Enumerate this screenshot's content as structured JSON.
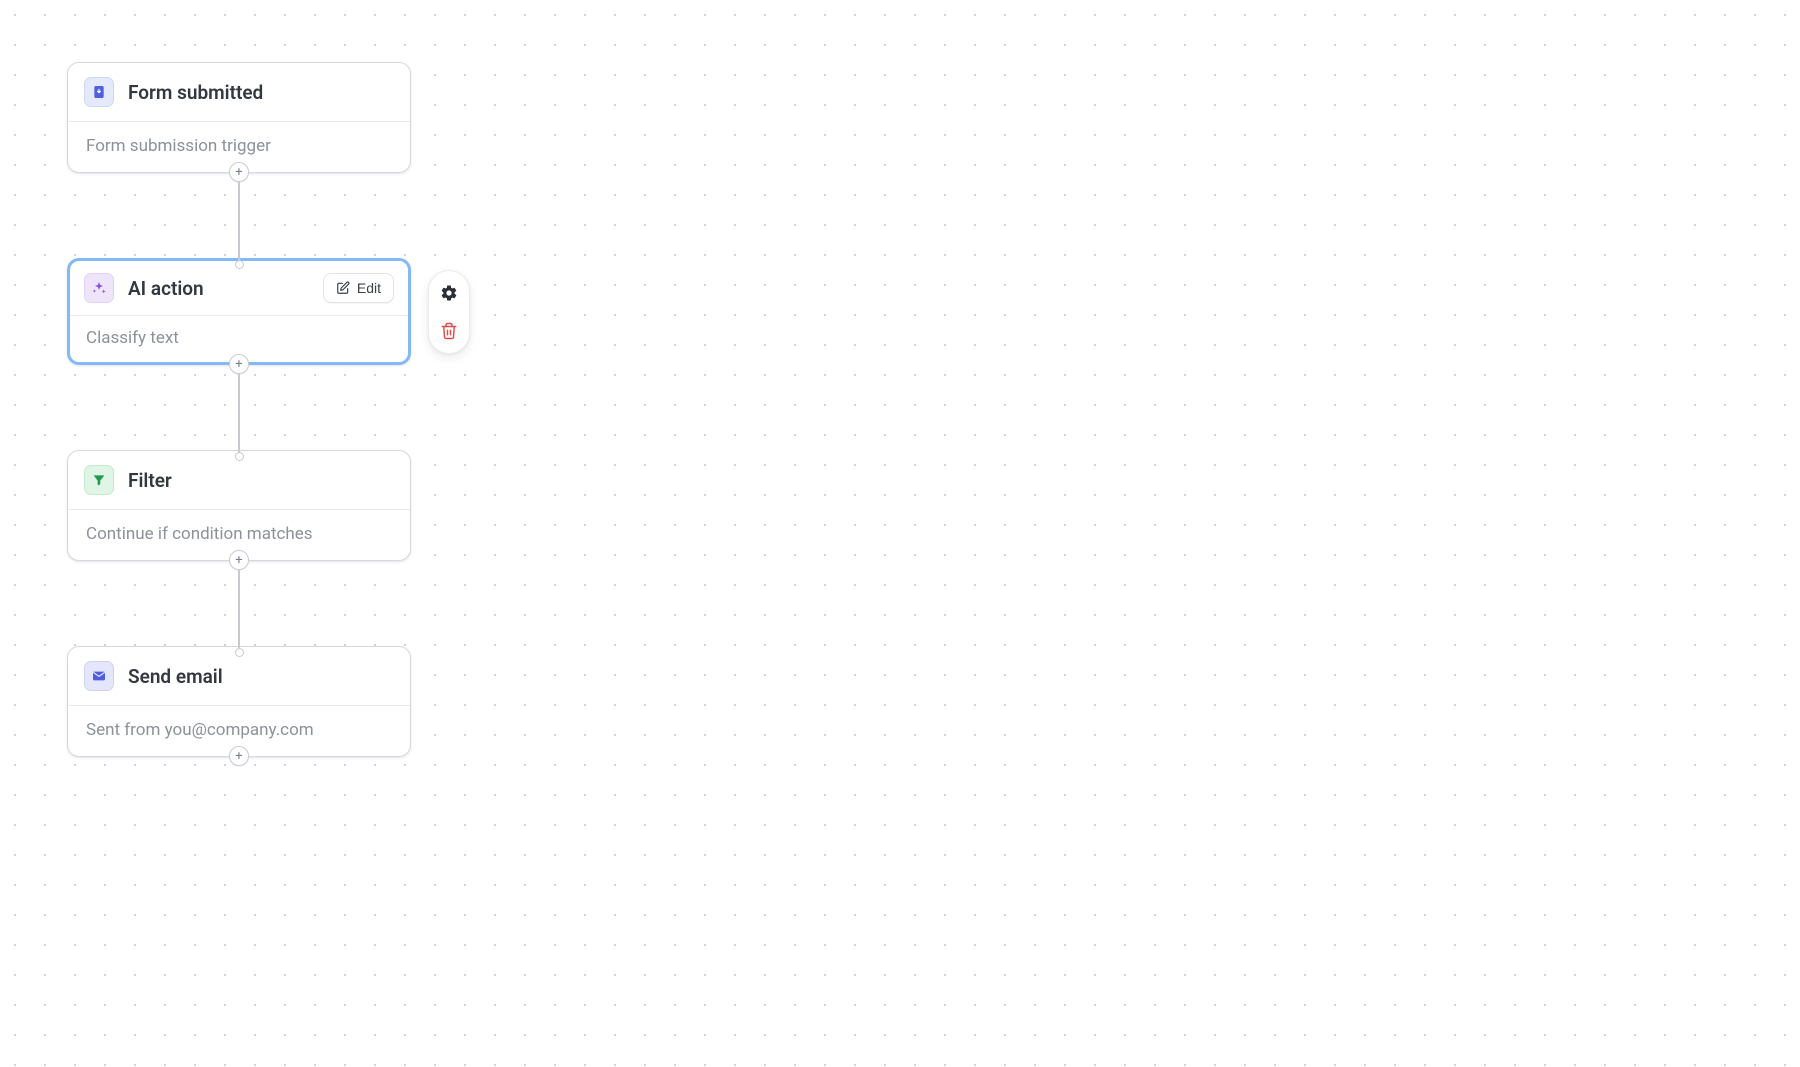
{
  "flow": {
    "nodes": [
      {
        "id": "trigger-form-submitted",
        "icon": "form-submit-icon",
        "icon_color": "blue",
        "title": "Form submitted",
        "description": "Form submission trigger",
        "selected": false
      },
      {
        "id": "ai-action",
        "icon": "sparkle-icon",
        "icon_color": "purple",
        "title": "AI action",
        "description": "Classify text",
        "selected": true,
        "edit_label": "Edit"
      },
      {
        "id": "filter",
        "icon": "filter-icon",
        "icon_color": "green",
        "title": "Filter",
        "description": "Continue if condition matches",
        "selected": false
      },
      {
        "id": "send-email",
        "icon": "mail-icon",
        "icon_color": "indigo",
        "title": "Send email",
        "description": "Sent from you@company.com",
        "selected": false
      }
    ]
  },
  "side_actions": {
    "settings": "settings-icon",
    "delete": "trash-icon"
  },
  "colors": {
    "selected_border": "#84b9f8",
    "icon_blue_bg": "#e4e9fb",
    "icon_purple_bg": "#efe5fb",
    "icon_green_bg": "#dff5e5",
    "icon_indigo_bg": "#e4e6fb",
    "text_primary": "#33373f",
    "text_secondary": "#8c919b"
  }
}
